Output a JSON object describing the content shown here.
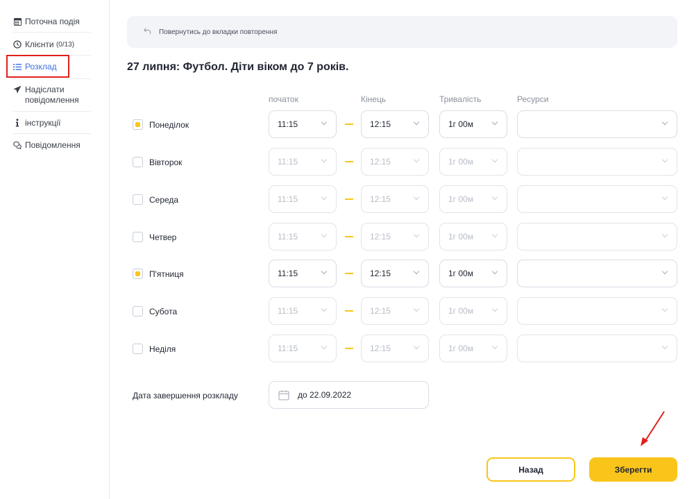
{
  "sidebar": {
    "items": [
      {
        "label": "Поточна подія",
        "icon": "calendar-icon"
      },
      {
        "label": "Клієнти",
        "count": "(0/13)",
        "icon": "clock-icon"
      },
      {
        "label": "Розклад",
        "icon": "list-icon",
        "active": true
      },
      {
        "label": "Надіслати повідомлення",
        "icon": "send-icon"
      },
      {
        "label": "інструкції",
        "icon": "info-icon"
      },
      {
        "label": "Повідомлення",
        "icon": "chat-icon"
      }
    ]
  },
  "back_bar": {
    "label": "Повернутись до вкладки повторення",
    "icon": "undo-icon"
  },
  "title": "27 липня: Футбол. Діти віком до 7 років.",
  "columns": {
    "start": "початок",
    "end": "Кінець",
    "duration": "Тривалість",
    "resources": "Ресурси"
  },
  "days": [
    {
      "name": "Понеділок",
      "checked": true,
      "start": "11:15",
      "end": "12:15",
      "duration": "1г 00м",
      "resource": ""
    },
    {
      "name": "Вівторок",
      "checked": false,
      "start": "11:15",
      "end": "12:15",
      "duration": "1г 00м",
      "resource": ""
    },
    {
      "name": "Середа",
      "checked": false,
      "start": "11:15",
      "end": "12:15",
      "duration": "1г 00м",
      "resource": ""
    },
    {
      "name": "Четвер",
      "checked": false,
      "start": "11:15",
      "end": "12:15",
      "duration": "1г 00м",
      "resource": ""
    },
    {
      "name": "П'ятниця",
      "checked": true,
      "start": "11:15",
      "end": "12:15",
      "duration": "1г 00м",
      "resource": ""
    },
    {
      "name": "Субота",
      "checked": false,
      "start": "11:15",
      "end": "12:15",
      "duration": "1г 00м",
      "resource": ""
    },
    {
      "name": "Неділя",
      "checked": false,
      "start": "11:15",
      "end": "12:15",
      "duration": "1г 00м",
      "resource": ""
    }
  ],
  "schedule_end": {
    "label": "Дата завершення розкладу",
    "value": "до 22.09.2022",
    "icon": "calendar-outline-icon"
  },
  "buttons": {
    "back": "Назад",
    "save": "Зберегти"
  },
  "colors": {
    "accent": "#f9c51b",
    "active_link": "#3d6fe0",
    "highlight_box": "#e0201b",
    "arrow": "#e0201b"
  }
}
